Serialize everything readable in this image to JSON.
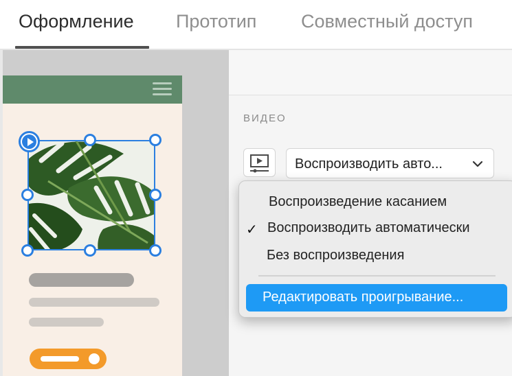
{
  "tabs": [
    {
      "label": "Оформление",
      "active": true
    },
    {
      "label": "Прототип",
      "active": false
    },
    {
      "label": "Совместный доступ",
      "active": false
    }
  ],
  "panel": {
    "section_label": "ВИДЕО",
    "video_icon": "video-player-icon",
    "playback_select": {
      "value": "Воспроизводить авто...",
      "chevron_icon": "chevron-down-icon"
    },
    "menu": {
      "items": [
        {
          "label": "Воспроизведение касанием",
          "checked": false
        },
        {
          "label": "Воспроизводить автоматически",
          "checked": true
        },
        {
          "label": "Без воспроизведения",
          "checked": false
        }
      ],
      "check_mark": "✓",
      "highlighted_item": "Редактировать проигрывание..."
    }
  },
  "canvas": {
    "header_color": "#5f8a6b",
    "artboard_color": "#f9efe6",
    "cta_color": "#f39a2a",
    "selection_color": "#2b7fe0",
    "menu_icon": "hamburger-icon",
    "video_badge_icon": "play-icon"
  }
}
